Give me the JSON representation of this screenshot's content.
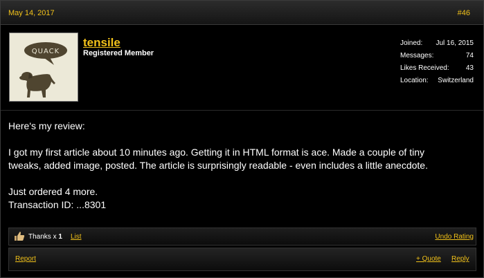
{
  "post": {
    "date": "May 14, 2017",
    "number": "#46"
  },
  "user": {
    "name": "tensile",
    "title": "Registered Member",
    "avatar_bubble_text": "QUACK",
    "stats": [
      {
        "label": "Joined:",
        "value": "Jul 16, 2015"
      },
      {
        "label": "Messages:",
        "value": "74"
      },
      {
        "label": "Likes Received:",
        "value": "43"
      },
      {
        "label": "Location:",
        "value": "Switzerland"
      }
    ]
  },
  "message": {
    "line1": "Here's my review:",
    "para2_line1": "I got my first article about 10 minutes ago. Getting it in HTML format is ace. Made a couple of tiny",
    "para2_line2": "tweaks, added image, posted. The article is surprisingly readable - even includes a little anecdote.",
    "line3": "Just ordered 4 more.",
    "line4": "Transaction ID: ...8301"
  },
  "likes": {
    "thanks_prefix": "Thanks x",
    "thanks_count": "1",
    "list_label": "List",
    "undo_label": "Undo Rating"
  },
  "footer": {
    "report_label": "Report",
    "quote_label": "+ Quote",
    "reply_label": "Reply"
  },
  "colors": {
    "link": "#f2c21a",
    "background": "#000000",
    "text": "#ffffff"
  }
}
